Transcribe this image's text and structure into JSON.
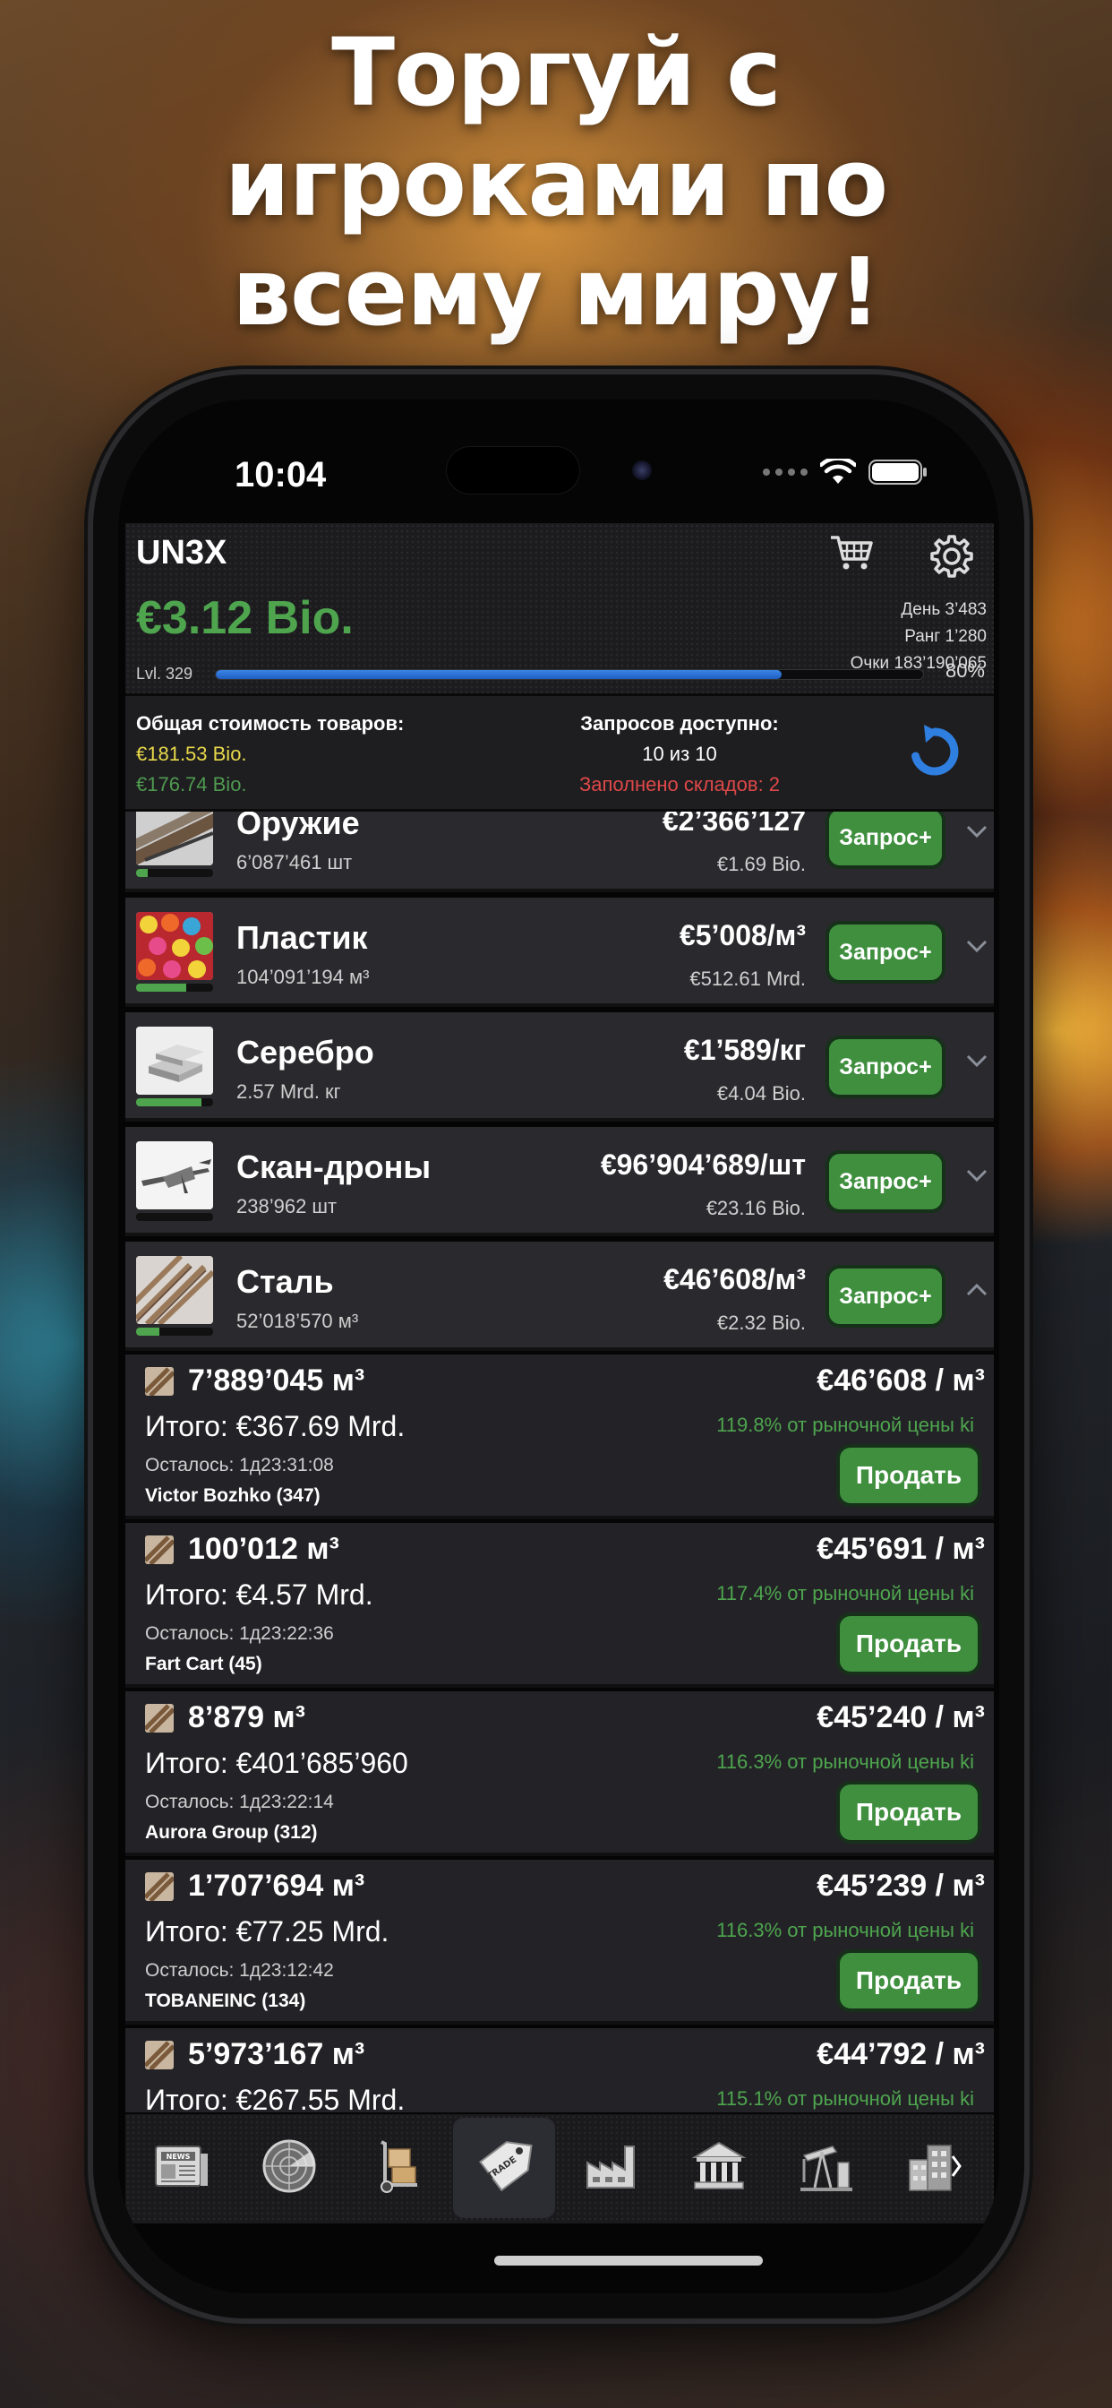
{
  "headline": [
    "Торгуй с",
    "игроками по",
    "всему миру!"
  ],
  "status_bar": {
    "time": "10:04"
  },
  "header": {
    "company": "UN3X",
    "money": "€3.12 Bio.",
    "stats": [
      "День 3’483",
      "Ранг 1’280",
      "Очки 183’190’065"
    ],
    "level_label": "Lvl. 329",
    "level_progress": 0.8,
    "level_percent": "80%",
    "icons": [
      "cart-icon",
      "gear-icon"
    ]
  },
  "summary": {
    "title": "Общая стоимость товаров:",
    "value_yellow": "€181.53 Bio.",
    "value_green": "€176.74 Bio.",
    "requests_title": "Запросов доступно:",
    "requests_value": "10 из 10",
    "warehouses": "Заполнено складов: 2"
  },
  "categories": [
    {
      "name": "Оружие",
      "qty": "6’087’461 шт",
      "price": "€2’366’127",
      "total": "€1.69 Bio.",
      "button": "Запрос+",
      "stock": 0.15,
      "icon": "weapons-icon",
      "expanded": false
    },
    {
      "name": "Пластик",
      "qty": "104’091’194 м³",
      "price": "€5’008/м³",
      "total": "€512.61 Mrd.",
      "button": "Запрос+",
      "stock": 0.65,
      "icon": "plastic-icon",
      "expanded": false
    },
    {
      "name": "Серебро",
      "qty": "2.57 Mrd. кг",
      "price": "€1’589/кг",
      "total": "€4.04 Bio.",
      "button": "Запрос+",
      "stock": 0.85,
      "icon": "silver-icon",
      "expanded": false
    },
    {
      "name": "Скан-дроны",
      "qty": "238’962 шт",
      "price": "€96’904’689/шт",
      "total": "€23.16 Bio.",
      "button": "Запрос+",
      "stock": 0.0,
      "icon": "drone-icon",
      "expanded": false
    },
    {
      "name": "Сталь",
      "qty": "52’018’570 м³",
      "price": "€46’608/м³",
      "total": "€2.32 Bio.",
      "button": "Запрос+",
      "stock": 0.3,
      "icon": "steel-icon",
      "expanded": true
    }
  ],
  "offers": [
    {
      "qty": "7’889’045 м³",
      "price": "€46’608 / м³",
      "total": "Итого:  €367.69 Mrd.",
      "percent": "119.8% от рыночной цены ki",
      "time_left": "Осталось: 1д23:31:08",
      "user": "Victor Bozhko (347)",
      "button": "Продать"
    },
    {
      "qty": "100’012 м³",
      "price": "€45’691 / м³",
      "total": "Итого:  €4.57 Mrd.",
      "percent": "117.4% от рыночной цены ki",
      "time_left": "Осталось: 1д23:22:36",
      "user": "Fart Cart (45)",
      "button": "Продать"
    },
    {
      "qty": "8’879 м³",
      "price": "€45’240 / м³",
      "total": "Итого:  €401’685’960",
      "percent": "116.3% от рыночной цены ki",
      "time_left": "Осталось: 1д23:22:14",
      "user": "Aurora Group (312)",
      "button": "Продать"
    },
    {
      "qty": "1’707’694 м³",
      "price": "€45’239 / м³",
      "total": "Итого:  €77.25 Mrd.",
      "percent": "116.3% от рыночной цены ki",
      "time_left": "Осталось: 1д23:12:42",
      "user": "TOBANEINC (134)",
      "button": "Продать"
    },
    {
      "qty": "5’973’167 м³",
      "price": "€44’792 / м³",
      "total": "Итого:  €267.55 Mrd.",
      "percent": "115.1% от рыночной цены ki",
      "time_left": "",
      "user": "",
      "button": ""
    }
  ],
  "tabbar": {
    "tabs": [
      {
        "name": "news",
        "label": "NEWS",
        "icon": "newspaper-icon",
        "active": false
      },
      {
        "name": "radar",
        "label": "",
        "icon": "radar-icon",
        "active": false
      },
      {
        "name": "logistics",
        "label": "",
        "icon": "hand-truck-icon",
        "active": false
      },
      {
        "name": "trade",
        "label": "TRADE",
        "icon": "price-tag-icon",
        "active": true
      },
      {
        "name": "factory",
        "label": "",
        "icon": "factory-icon",
        "active": false
      },
      {
        "name": "bank",
        "label": "",
        "icon": "bank-icon",
        "active": false
      },
      {
        "name": "oil",
        "label": "",
        "icon": "oil-pump-icon",
        "active": false
      },
      {
        "name": "buildings",
        "label": "",
        "icon": "buildings-icon",
        "active": false
      }
    ]
  }
}
